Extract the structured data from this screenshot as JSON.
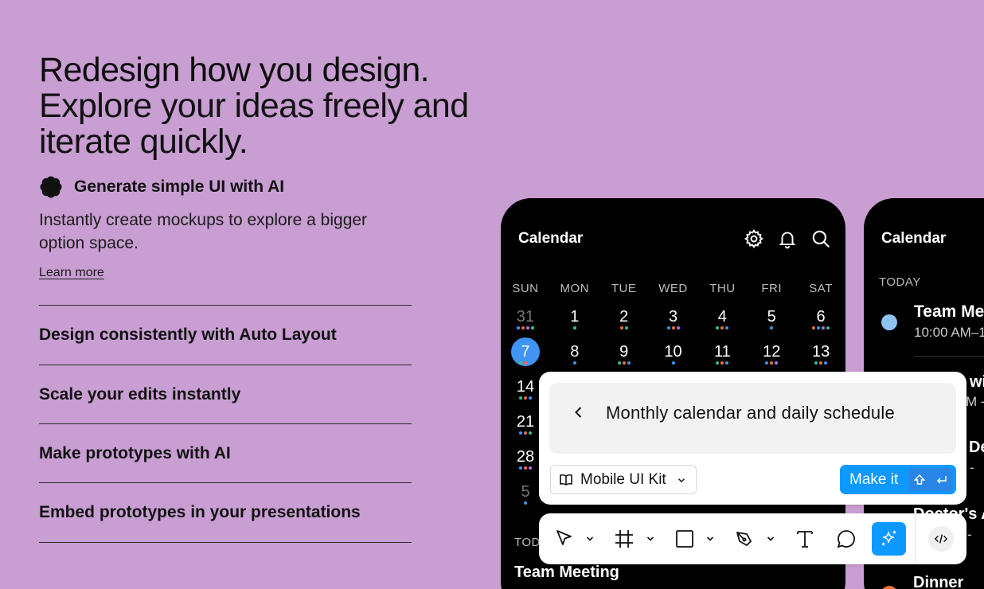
{
  "headline": {
    "bold": "Redesign how you design.",
    "rest": "Explore your ideas freely and iterate quickly."
  },
  "features": {
    "active": {
      "title": "Generate simple UI with AI",
      "description": "Instantly create mockups to explore a bigger option space.",
      "link": "Learn more"
    },
    "items": [
      "Design consistently with Auto Layout",
      "Scale your edits instantly",
      "Make prototypes with AI",
      "Embed prototypes in your presentations"
    ]
  },
  "phone1": {
    "title": "Calendar",
    "weekdays": [
      "SUN",
      "MON",
      "TUE",
      "WED",
      "THU",
      "FRI",
      "SAT"
    ],
    "weeks": [
      [
        "31",
        "1",
        "2",
        "3",
        "4",
        "5",
        "6"
      ],
      [
        "7",
        "8",
        "9",
        "10",
        "11",
        "12",
        "13"
      ],
      [
        "14"
      ],
      [
        "21"
      ],
      [
        "28"
      ],
      [
        "5"
      ]
    ],
    "today_label": "TOD",
    "event_title": "Team Meeting"
  },
  "phone2": {
    "title": "Calendar",
    "today_label": "TODAY",
    "event_title": "Team Mee",
    "event_time": "10:00 AM–1",
    "frag1": "wit",
    "frag1_sub": "M -",
    "frag2": "De",
    "frag2_sub": "-",
    "frag3": "Doctor's A",
    "frag3_sub": "-",
    "frag4": "Dinner"
  },
  "prompt": {
    "text": "Monthly calendar and daily schedule",
    "kit_label": "Mobile UI Kit",
    "make_label": "Make it"
  },
  "colors": {
    "background": "#c99ed3",
    "accent": "#0d99ff",
    "today_circle": "#3f94f4"
  }
}
